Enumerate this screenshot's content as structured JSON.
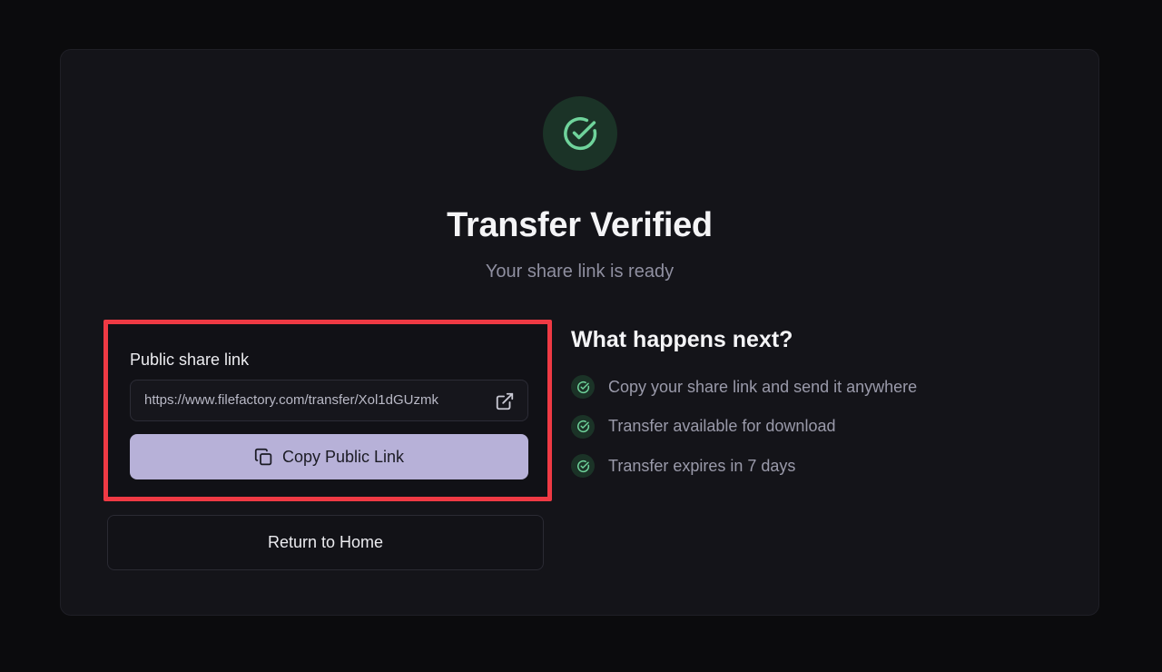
{
  "header": {
    "title": "Transfer Verified",
    "subtitle": "Your share link is ready"
  },
  "share": {
    "label": "Public share link",
    "url": "https://www.filefactory.com/transfer/Xol1dGUzmk",
    "copy_label": "Copy Public Link"
  },
  "actions": {
    "home_label": "Return to Home"
  },
  "next_steps": {
    "title": "What happens next?",
    "items": [
      {
        "text": "Copy your share link and send it anywhere"
      },
      {
        "text": "Transfer available for download"
      },
      {
        "text": "Transfer expires in 7 days"
      }
    ]
  },
  "icons": {
    "hero": "check-circle-icon",
    "open": "external-link-icon",
    "copy": "copy-icon",
    "step": "check-circle-icon"
  },
  "colors": {
    "accent_green": "#6fd39b",
    "badge_green": "#1b3327",
    "button_lavender": "#b7b1d8",
    "highlight_red": "#ef3a44",
    "background": "#0b0b0d",
    "card": "#141419"
  }
}
